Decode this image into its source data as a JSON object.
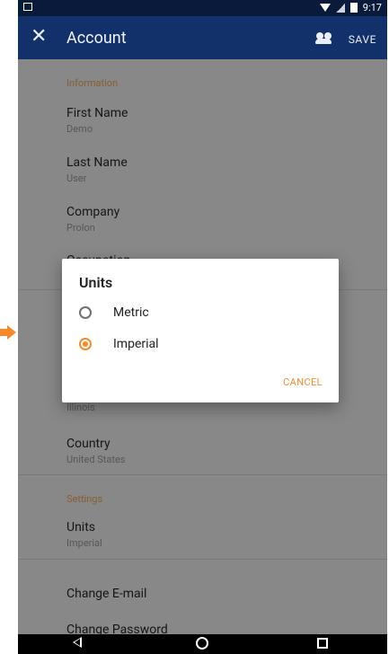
{
  "status_bar": {
    "time": "9:17"
  },
  "app_bar": {
    "title": "Account",
    "save_label": "SAVE"
  },
  "sections": {
    "information": {
      "header": "Information",
      "fields": [
        {
          "label": "First Name",
          "value": "Demo"
        },
        {
          "label": "Last Name",
          "value": "User"
        },
        {
          "label": "Company",
          "value": "Prolon"
        },
        {
          "label": "Occupation",
          "value": ""
        }
      ]
    },
    "address": {
      "fields": [
        {
          "label": "",
          "value": "Illinois"
        },
        {
          "label": "Country",
          "value": "United States"
        }
      ]
    },
    "settings": {
      "header": "Settings",
      "fields": [
        {
          "label": "Units",
          "value": "Imperial"
        }
      ]
    },
    "actions": [
      "Change E-mail",
      "Change Password"
    ]
  },
  "dialog": {
    "title": "Units",
    "options": [
      {
        "label": "Metric",
        "selected": false
      },
      {
        "label": "Imperial",
        "selected": true
      }
    ],
    "cancel_label": "CANCEL"
  },
  "accent_color": "#f68a2a",
  "app_bar_color": "#12306a",
  "status_bar_color": "#0a1a3a"
}
